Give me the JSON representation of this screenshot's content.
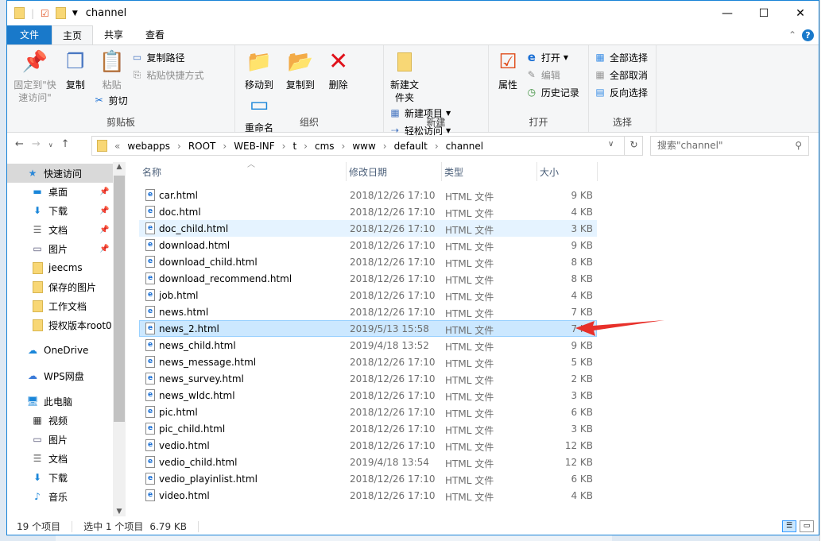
{
  "window": {
    "title": "channel",
    "controls": [
      "—",
      "☐",
      "✕"
    ]
  },
  "tabs": [
    {
      "label": "文件"
    },
    {
      "label": "主页"
    },
    {
      "label": "共享"
    },
    {
      "label": "查看"
    }
  ],
  "ribbon": {
    "clipboard": {
      "label": "剪贴板",
      "pin": "固定到\"快速访问\"",
      "copy": "复制",
      "paste": "粘贴",
      "copy_path": "复制路径",
      "paste_shortcut": "粘贴快捷方式",
      "cut": "剪切"
    },
    "organize": {
      "label": "组织",
      "move_to": "移动到",
      "copy_to": "复制到",
      "delete": "删除",
      "rename": "重命名"
    },
    "new": {
      "label": "新建",
      "new_folder": "新建文件夹",
      "new_item": "新建项目",
      "easy_access": "轻松访问"
    },
    "open": {
      "label": "打开",
      "properties": "属性",
      "open": "打开",
      "edit": "编辑",
      "history": "历史记录"
    },
    "select": {
      "label": "选择",
      "select_all": "全部选择",
      "select_none": "全部取消",
      "invert": "反向选择"
    }
  },
  "address": {
    "crumbs": [
      "webapps",
      "ROOT",
      "WEB-INF",
      "t",
      "cms",
      "www",
      "default",
      "channel"
    ],
    "search_placeholder": "搜索\"channel\""
  },
  "sidebar": [
    {
      "label": "快速访问",
      "icon": "star-icon"
    },
    {
      "label": "桌面",
      "icon": "desktop-icon",
      "pinned": true
    },
    {
      "label": "下载",
      "icon": "download-icon",
      "pinned": true
    },
    {
      "label": "文档",
      "icon": "document-icon",
      "pinned": true
    },
    {
      "label": "图片",
      "icon": "picture-icon",
      "pinned": true
    },
    {
      "label": "jeecms",
      "icon": "folder-icon"
    },
    {
      "label": "保存的图片",
      "icon": "folder-icon"
    },
    {
      "label": "工作文档",
      "icon": "folder-icon"
    },
    {
      "label": "授权版本root0",
      "icon": "folder-icon"
    },
    {
      "label": "OneDrive",
      "icon": "cloud-icon"
    },
    {
      "label": "WPS网盘",
      "icon": "cloud-outline-icon"
    },
    {
      "label": "此电脑",
      "icon": "computer-icon"
    },
    {
      "label": "视频",
      "icon": "video-icon"
    },
    {
      "label": "图片",
      "icon": "picture-icon"
    },
    {
      "label": "文档",
      "icon": "document-icon"
    },
    {
      "label": "下载",
      "icon": "download-icon"
    },
    {
      "label": "音乐",
      "icon": "music-icon"
    }
  ],
  "columns": [
    "名称",
    "修改日期",
    "类型",
    "大小"
  ],
  "files": [
    {
      "name": "car.html",
      "date": "2018/12/26 17:10",
      "type": "HTML 文件",
      "size": "9 KB"
    },
    {
      "name": "doc.html",
      "date": "2018/12/26 17:10",
      "type": "HTML 文件",
      "size": "4 KB"
    },
    {
      "name": "doc_child.html",
      "date": "2018/12/26 17:10",
      "type": "HTML 文件",
      "size": "3 KB",
      "state": "hover"
    },
    {
      "name": "download.html",
      "date": "2018/12/26 17:10",
      "type": "HTML 文件",
      "size": "9 KB"
    },
    {
      "name": "download_child.html",
      "date": "2018/12/26 17:10",
      "type": "HTML 文件",
      "size": "8 KB"
    },
    {
      "name": "download_recommend.html",
      "date": "2018/12/26 17:10",
      "type": "HTML 文件",
      "size": "8 KB"
    },
    {
      "name": "job.html",
      "date": "2018/12/26 17:10",
      "type": "HTML 文件",
      "size": "4 KB"
    },
    {
      "name": "news.html",
      "date": "2018/12/26 17:10",
      "type": "HTML 文件",
      "size": "7 KB"
    },
    {
      "name": "news_2.html",
      "date": "2019/5/13 15:58",
      "type": "HTML 文件",
      "size": "7 KB",
      "state": "selected"
    },
    {
      "name": "news_child.html",
      "date": "2019/4/18 13:52",
      "type": "HTML 文件",
      "size": "9 KB"
    },
    {
      "name": "news_message.html",
      "date": "2018/12/26 17:10",
      "type": "HTML 文件",
      "size": "5 KB"
    },
    {
      "name": "news_survey.html",
      "date": "2018/12/26 17:10",
      "type": "HTML 文件",
      "size": "2 KB"
    },
    {
      "name": "news_wldc.html",
      "date": "2018/12/26 17:10",
      "type": "HTML 文件",
      "size": "3 KB"
    },
    {
      "name": "pic.html",
      "date": "2018/12/26 17:10",
      "type": "HTML 文件",
      "size": "6 KB"
    },
    {
      "name": "pic_child.html",
      "date": "2018/12/26 17:10",
      "type": "HTML 文件",
      "size": "3 KB"
    },
    {
      "name": "vedio.html",
      "date": "2018/12/26 17:10",
      "type": "HTML 文件",
      "size": "12 KB"
    },
    {
      "name": "vedio_child.html",
      "date": "2019/4/18 13:54",
      "type": "HTML 文件",
      "size": "12 KB"
    },
    {
      "name": "vedio_playinlist.html",
      "date": "2018/12/26 17:10",
      "type": "HTML 文件",
      "size": "6 KB"
    },
    {
      "name": "video.html",
      "date": "2018/12/26 17:10",
      "type": "HTML 文件",
      "size": "4 KB"
    }
  ],
  "status": {
    "count": "19 个项目",
    "selected": "选中 1 个项目",
    "size": "6.79 KB"
  },
  "colors": {
    "accent": "#1979ca",
    "selected": "#cce8ff",
    "arrow": "#e8302a"
  }
}
